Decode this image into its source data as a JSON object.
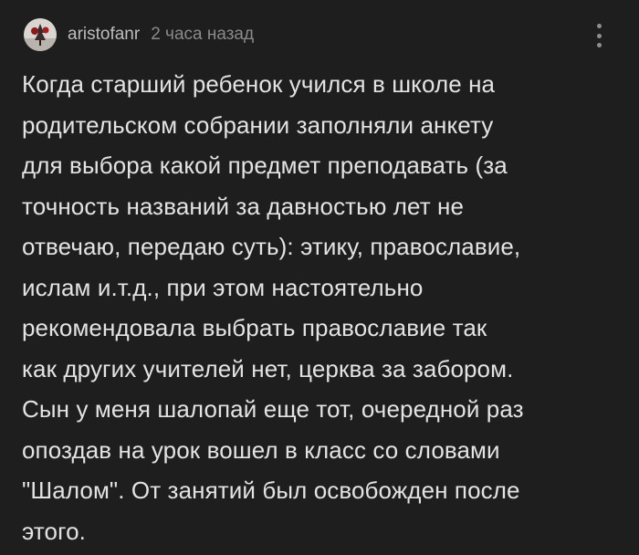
{
  "comment": {
    "author": "aristofanr",
    "timestamp": "2 часа назад",
    "avatar_icon": "avatar-image",
    "menu_icon": "vertical-dots-icon",
    "body": "Когда старший ребенок учился в школе на\nродительском собрании заполняли анкету\nдля выбора какой предмет преподавать (за\nточность названий за давностью лет не\nотвечаю, передаю суть): этику, православие,\nислам и.т.д., при этом настоятельно\nрекомендовала выбрать православие так\nкак других учителей нет, церква за забором.\nСын у меня шалопай еще тот, очередной раз\nопоздав на урок вошел в класс со словами\n\"Шалом\". От занятий был освобожден после\nэтого."
  },
  "colors": {
    "background": "#1e1e1f",
    "text": "#e3e3e3",
    "username": "#bdbdbd",
    "timestamp": "#8a8a8a",
    "menu_dots": "#8f8f8f"
  }
}
